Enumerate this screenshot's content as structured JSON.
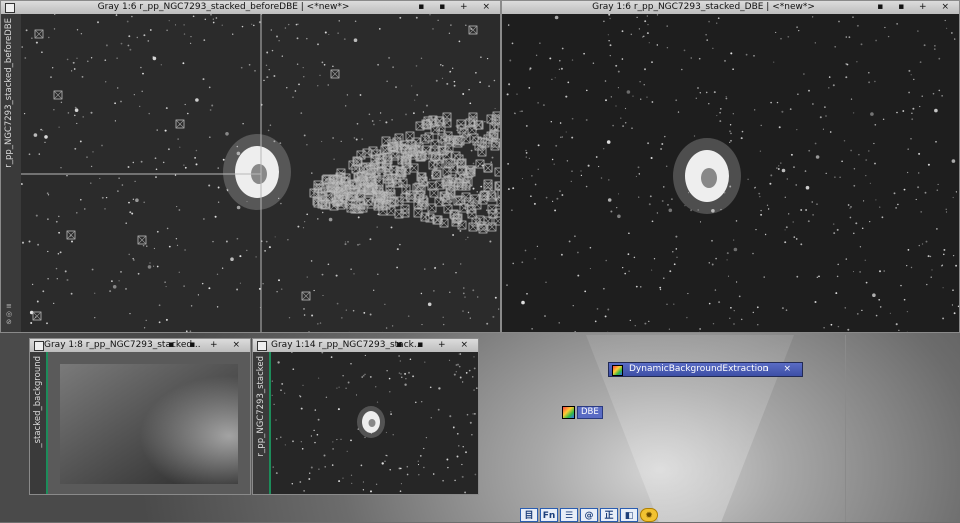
{
  "windows": {
    "before": {
      "title": "Gray 1:6 r_pp_NGC7293_stacked_beforeDBE | <*new*>",
      "side_label": "r_pp_NGC7293_stacked_beforeDBE",
      "controls": "▪ ▪ + ×"
    },
    "dbe": {
      "title": "Gray 1:6 r_pp_NGC7293_stacked_DBE | <*new*>",
      "controls": "▪ ▪ + ×"
    },
    "background": {
      "title": "Gray 1:8 r_pp_NGC7293_stacked...",
      "side_label": "_stacked_background",
      "controls": "▪ ▪ + ×"
    },
    "small": {
      "title": "Gray 1:14 r_pp_NGC7293_stack...",
      "side_label": "r_pp_NGC7293_stacked",
      "controls": "▪ ▪ + ×"
    }
  },
  "process_window": {
    "title": "DynamicBackgroundExtraction",
    "controls": "▫ ×",
    "icon": "pi-process-icon"
  },
  "process_icon": {
    "label": "DBE",
    "icon": "pi-process-icon"
  },
  "toolbar": {
    "items": [
      {
        "name": "explorer-icon",
        "glyph": "目"
      },
      {
        "name": "function-icon",
        "glyph": "Fn"
      },
      {
        "name": "list-icon",
        "glyph": "☰"
      },
      {
        "name": "at-icon",
        "glyph": "@"
      },
      {
        "name": "script-icon",
        "glyph": "正"
      },
      {
        "name": "window-icon",
        "glyph": "◧"
      },
      {
        "name": "gear-icon",
        "glyph": "✹"
      }
    ]
  },
  "colors": {
    "accent_green": "#1d8c5a",
    "process_blue": "#4a5cb8",
    "title_bar": "#cfcfcf"
  }
}
